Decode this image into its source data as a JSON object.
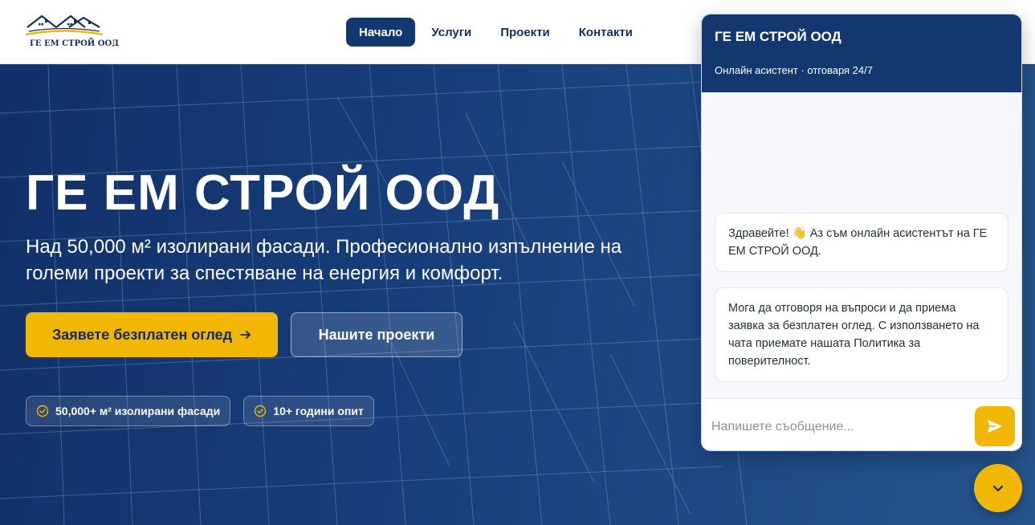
{
  "header": {
    "logo_text": "ГЕ ЕМ СТРОЙ ООД",
    "nav": [
      {
        "label": "Начало",
        "active": true
      },
      {
        "label": "Услуги",
        "active": false
      },
      {
        "label": "Проекти",
        "active": false
      },
      {
        "label": "Контакти",
        "active": false
      }
    ]
  },
  "hero": {
    "title": "ГЕ ЕМ СТРОЙ ООД",
    "subtitle": "Над 50,000 м² изолирани фасади. Професионално изпълнение на големи проекти за спестяване на енергия и комфорт.",
    "primary_button": "Заявете безплатен оглед",
    "secondary_button": "Нашите проекти",
    "badges": [
      "50,000+ м² изолирани фасади",
      "10+ години опит"
    ]
  },
  "chat": {
    "title": "ГЕ ЕМ СТРОЙ ООД",
    "status": "Онлайн асистент · отговаря 24/7",
    "messages": [
      "Здравейте! 👋 Аз съм онлайн асистентът на ГЕ ЕМ СТРОЙ ООД.",
      "Мога да отговоря на въпроси и да приема заявка за безплатен оглед. С използването на чата приемате нашата Политика за поверителност."
    ],
    "input_placeholder": "Напишете съобщение..."
  },
  "icons": {
    "arrow": "arrow-right-icon",
    "badge": "check-circle-icon",
    "send": "send-icon",
    "toggle": "chevron-down-icon"
  },
  "colors": {
    "brand_navy": "#12386f",
    "accent_yellow": "#f2b705"
  }
}
